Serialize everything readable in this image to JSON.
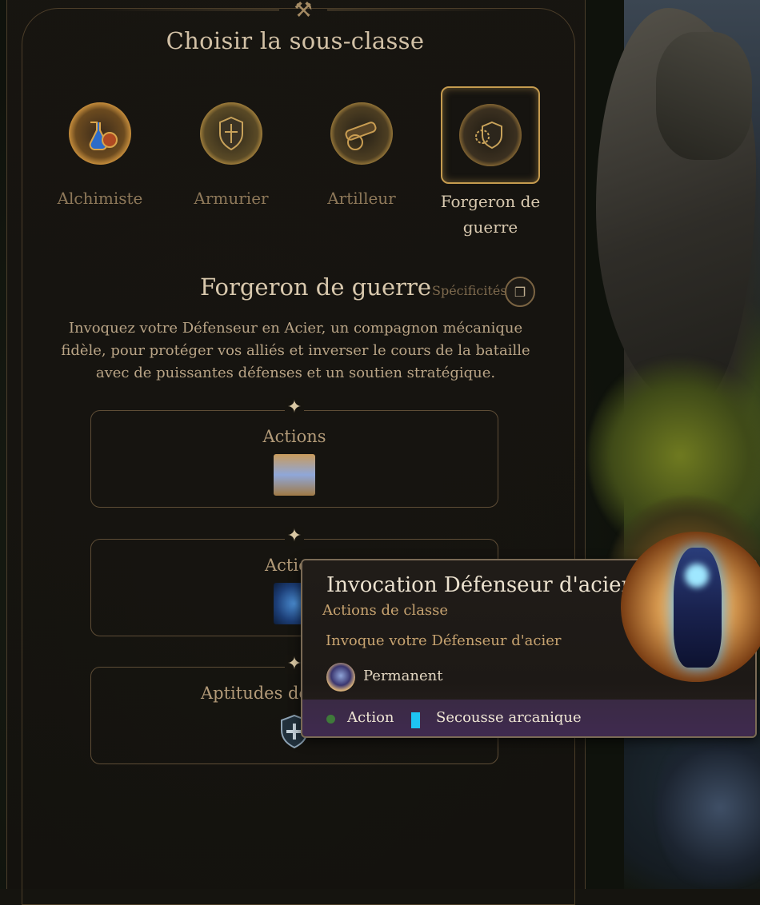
{
  "window": {
    "title": "Choisir la sous-classe"
  },
  "subclasses": [
    {
      "label": "Alchimiste",
      "icon": "potion-icon",
      "selected": false
    },
    {
      "label": "Armurier",
      "icon": "armor-icon",
      "selected": false
    },
    {
      "label": "Artilleur",
      "icon": "cannon-icon",
      "selected": false
    },
    {
      "label": "Forgeron de guerre",
      "icon": "shield-gear-icon",
      "selected": true
    }
  ],
  "detail": {
    "name": "Forgeron de guerre",
    "specs_label": "Spécificités",
    "description": "Invoquez votre Défenseur en Acier, un compagnon mécanique fidèle, pour protéger vos alliés et inverser le cours de la bataille avec de puissantes défenses et un soutien stratégique."
  },
  "sections": [
    {
      "title": "Actions"
    },
    {
      "title": "Actio"
    },
    {
      "title": "Aptitudes de"
    }
  ],
  "tooltip": {
    "title": "Invocation Défenseur d'acier",
    "category": "Actions de classe",
    "description": "Invoque votre Défenseur d'acier",
    "duration": "Permanent",
    "cost_action": "Action",
    "cost_resource": "Secousse arcanique",
    "colors": {
      "action_dot": "#3f7a3a",
      "resource_bar": "#1ec4f2"
    }
  }
}
